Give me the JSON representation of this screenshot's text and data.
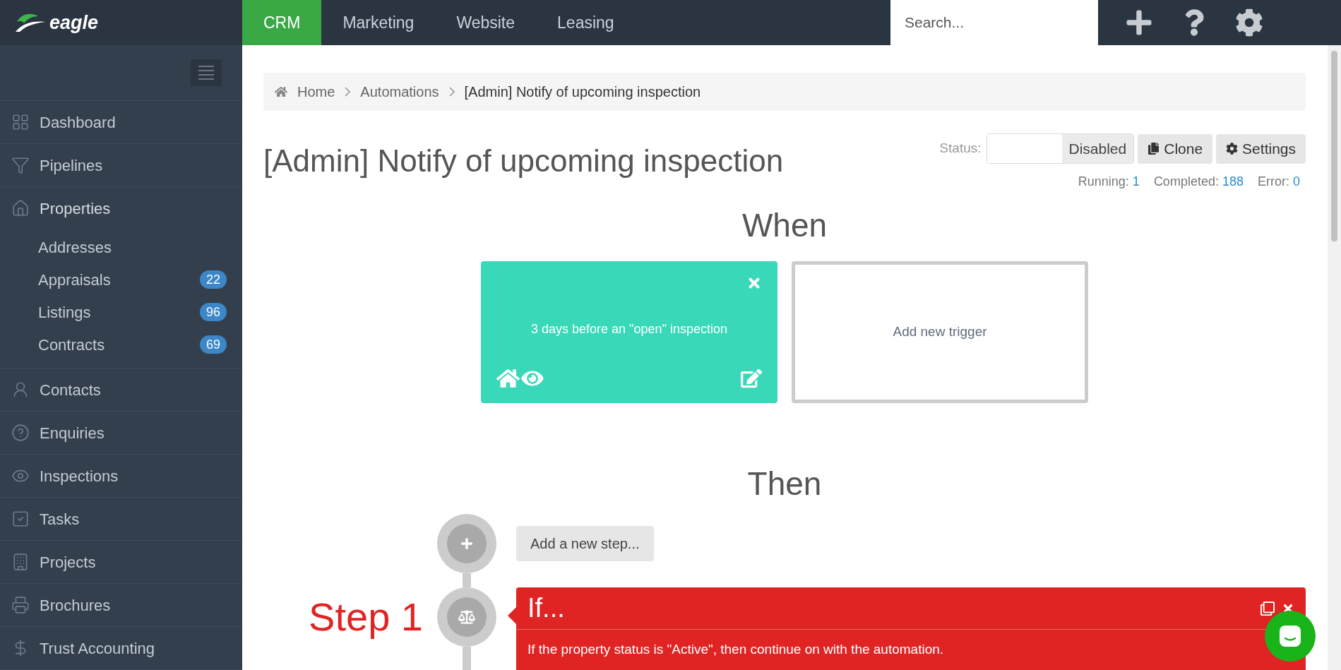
{
  "brand": {
    "name": "eagle"
  },
  "top_nav": [
    {
      "label": "CRM",
      "selected": true
    },
    {
      "label": "Marketing",
      "selected": false
    },
    {
      "label": "Website",
      "selected": false
    },
    {
      "label": "Leasing",
      "selected": false
    }
  ],
  "search": {
    "placeholder": "Search..."
  },
  "sidebar": {
    "items": [
      {
        "label": "Dashboard",
        "expanded": false
      },
      {
        "label": "Pipelines",
        "expanded": false
      },
      {
        "label": "Properties",
        "expanded": true,
        "children": [
          {
            "label": "Addresses"
          },
          {
            "label": "Appraisals",
            "badge": "22"
          },
          {
            "label": "Listings",
            "badge": "96"
          },
          {
            "label": "Contracts",
            "badge": "69"
          }
        ]
      },
      {
        "label": "Contacts",
        "expanded": false
      },
      {
        "label": "Enquiries",
        "expanded": false
      },
      {
        "label": "Inspections",
        "expanded": false
      },
      {
        "label": "Tasks",
        "expanded": false
      },
      {
        "label": "Projects",
        "expanded": false
      },
      {
        "label": "Brochures",
        "expanded": false
      },
      {
        "label": "Trust Accounting",
        "expanded": false
      }
    ]
  },
  "breadcrumb": [
    "Home",
    "Automations",
    "[Admin] Notify of upcoming inspection"
  ],
  "page_title": "[Admin] Notify of upcoming inspection",
  "status": {
    "label": "Status:",
    "value": "Disabled",
    "on": false
  },
  "actions": [
    "Clone",
    "Settings"
  ],
  "stats": [
    {
      "label": "Running:",
      "value": "1"
    },
    {
      "label": "Completed:",
      "value": "188"
    },
    {
      "label": "Error:",
      "value": "0"
    }
  ],
  "when": {
    "heading": "When",
    "triggers": [
      {
        "kind": "trigger",
        "text": "3 days before an \"open\" inspection"
      },
      {
        "kind": "add",
        "text": "Add new trigger"
      }
    ]
  },
  "then": {
    "heading": "Then",
    "add_step": "Add a new step...",
    "steps": [
      {
        "label": "Step 1",
        "title": "If...",
        "description": "If the property status is \"Active\", then continue on with the automation."
      }
    ]
  }
}
